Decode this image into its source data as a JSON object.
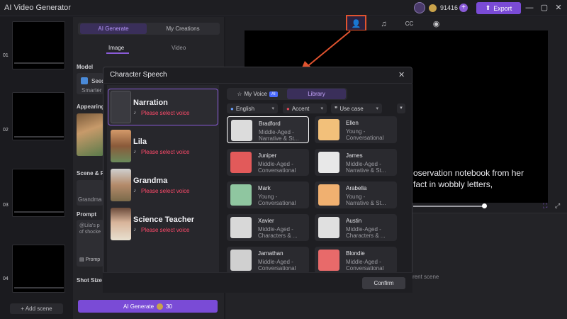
{
  "app": {
    "title": "AI Video Generator",
    "coins": "91416",
    "plus": "+",
    "export_label": "Export"
  },
  "scenes": {
    "numbers": [
      "01",
      "02",
      "03",
      "04"
    ],
    "add_label": "+ Add scene"
  },
  "panel": {
    "tabs": {
      "ai_generate": "AI Generate",
      "my_creations": "My Creations"
    },
    "subtabs": {
      "image": "Image",
      "video": "Video"
    },
    "model_label": "Model",
    "model_name": "Seed",
    "model_sub": "Smarter",
    "appearing_label": "Appearing",
    "scene_label": "Scene & P",
    "scene_value": "Grandma",
    "prompt_label": "Prompt",
    "prompt_text": "@Lila's p of shocke",
    "prompt_btn": "Promp",
    "shot_size_label": "Shot Size",
    "ai_generate_btn": "AI Generate",
    "ai_generate_cost": "30"
  },
  "toolbar": {
    "icons": [
      "character-voice-icon",
      "music-icon",
      "captions-icon",
      "camera-icon"
    ]
  },
  "preview": {
    "subtitle_line1": "oservation notebook from her",
    "subtitle_line2": "fact in wobbly letters,",
    "current_scene": "rent scene"
  },
  "modal": {
    "title": "Character Speech",
    "close": "✕",
    "characters": [
      {
        "name": "Narration",
        "status": "Please select voice",
        "selected": true
      },
      {
        "name": "Lila",
        "status": "Please select voice",
        "selected": false
      },
      {
        "name": "Grandma",
        "status": "Please select voice",
        "selected": false
      },
      {
        "name": "Science Teacher",
        "status": "Please select voice",
        "selected": false
      }
    ],
    "tabs": {
      "my_voice": "My Voice",
      "ai_badge": "AI",
      "library": "Library"
    },
    "filters": {
      "language": "English",
      "accent": "Accent",
      "use_case": "Use case"
    },
    "voices": [
      {
        "name": "Bradford",
        "line1": "Middle-Aged -",
        "line2": "Narrative & St...",
        "selected": true
      },
      {
        "name": "Ellen",
        "line1": "Young -",
        "line2": "Conversational",
        "selected": false
      },
      {
        "name": "Juniper",
        "line1": "Middle-Aged -",
        "line2": "Conversational",
        "selected": false
      },
      {
        "name": "James",
        "line1": "Middle-Aged -",
        "line2": "Narrative & St...",
        "selected": false
      },
      {
        "name": "Mark",
        "line1": "Young -",
        "line2": "Conversational",
        "selected": false
      },
      {
        "name": "Arabella",
        "line1": "Young -",
        "line2": "Narrative & St...",
        "selected": false
      },
      {
        "name": "Xavier",
        "line1": "Middle-Aged -",
        "line2": "Characters & ...",
        "selected": false
      },
      {
        "name": "Austin",
        "line1": "Middle-Aged -",
        "line2": "Characters & ...",
        "selected": false
      },
      {
        "name": "Jarnathan",
        "line1": "Middle-Aged -",
        "line2": "Conversational",
        "selected": false
      },
      {
        "name": "Blondie",
        "line1": "Middle-Aged -",
        "line2": "Conversational",
        "selected": false
      }
    ],
    "confirm": "Confirm"
  },
  "colors": {
    "accent": "#7a4bd6",
    "warning": "#ff4a6a",
    "highlight": "#e0532f"
  }
}
